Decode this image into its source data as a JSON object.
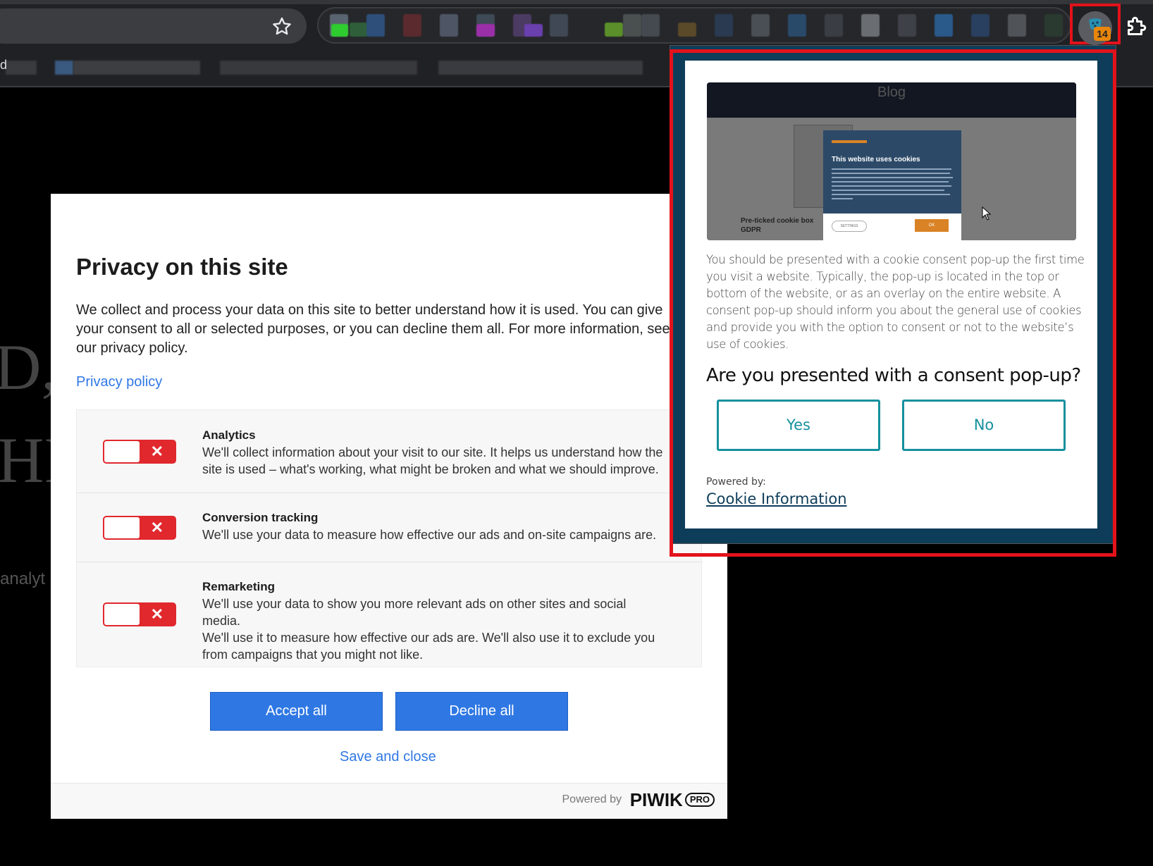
{
  "browser": {
    "extension_badge_count": "14",
    "bookmark_stub": "d"
  },
  "background_page": {
    "fragment_1": "D,",
    "fragment_2": "HI",
    "fragment_3": "analyt"
  },
  "piwik_modal": {
    "title": "Privacy on this site",
    "description_lines": [
      "We collect and process your data on this site to better understand how it is used. You can give",
      "your consent to all or selected purposes, or you can decline them all. For more information, see",
      "our privacy policy."
    ],
    "privacy_link": "Privacy policy",
    "purposes": [
      {
        "title": "Analytics",
        "description_lines": [
          "We'll collect information about your visit to our site. It helps us understand how the",
          "site is used – what's working, what might be broken and what we should improve."
        ],
        "enabled": false
      },
      {
        "title": "Conversion tracking",
        "description_lines": [
          "We'll use your data to measure how effective our ads and on-site campaigns are."
        ],
        "enabled": false
      },
      {
        "title": "Remarketing",
        "description_lines": [
          "We'll use your data to show you more relevant ads on other sites and social media.",
          "We'll use it to measure how effective our ads are. We'll also use it to exclude you",
          "from campaigns that you might not like."
        ],
        "enabled": false
      }
    ],
    "toggle_off_symbol": "✕",
    "accept_all_label": "Accept all",
    "decline_all_label": "Decline all",
    "save_close_label": "Save and close",
    "powered_by": "Powered by",
    "piwik_brand": "PIWIK",
    "piwik_pro": "PRO"
  },
  "extension_popup": {
    "preview": {
      "header": "Blog",
      "dialog_title": "This website uses cookies",
      "settings_label": "SETTINGS",
      "ok_label": "OK",
      "caption_lines": [
        "Pre-ticked cookie box",
        "GDPR"
      ]
    },
    "body_lines": [
      "You should be presented with a cookie consent pop-up the first time",
      "you visit a website. Typically, the pop-up is located in the top or",
      "bottom of the website, or as an overlay on the entire website. A",
      "consent pop-up should inform you about the general use of cookies",
      "and provide you with the option to consent or not to the website’s",
      "use of cookies."
    ],
    "question": "Are you presented with a consent pop-up?",
    "yes_label": "Yes",
    "no_label": "No",
    "powered_by": "Powered by:",
    "link_label": "Cookie Information",
    "colors": {
      "frame": "#0e3d5a",
      "accent": "#16909e",
      "highlight": "#e3121b"
    }
  }
}
